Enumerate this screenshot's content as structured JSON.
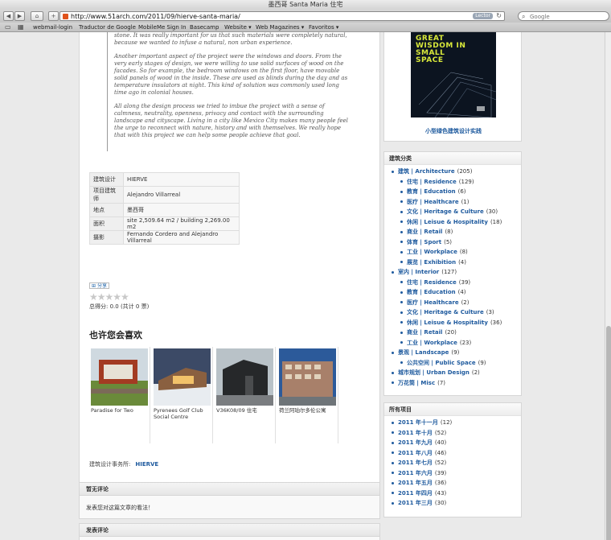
{
  "window": {
    "title": "墨西哥 Santa Maria 住宅",
    "url": "http://www.51arch.com/2011/09/hierve-santa-maria/",
    "reader_label": "Lector",
    "search_placeholder": "Google"
  },
  "bookmarks": [
    "webmail-login",
    "Traductor de Google",
    "MobileMe Sign In",
    "Basecamp",
    "Website ▾",
    "Web Magazines ▾",
    "Favoritos ▾"
  ],
  "article": {
    "paragraphs": [
      "stone. It was really important for us that such materials were completely natural, because we wanted to infuse a natural, non urban experience.",
      "Another important aspect of the project were the windows and doors. From the very early stages of design, we were willing to use solid surfaces of wood on the facades. So for example, the bedroom windows on the first floor, have movable solid panels of wood in the inside. These are used as blinds during the day and as temperature insulators at night. This kind of solution was commonly used long time ago in colonial houses.",
      "All along the design process we tried to imbue the project with a sense of calmness, neutrality, openness, privacy and contact with the surrounding landscape and cityscape. Living in a city like Mexico City makes many people feel the urge to reconnect with nature, history and with themselves. We really hope that with this project we can help some people achieve that goal."
    ],
    "info": [
      {
        "k": "建筑设计",
        "v": "HIERVE"
      },
      {
        "k": "项目建筑师",
        "v": "Alejandro Villarreal"
      },
      {
        "k": "地点",
        "v": "墨西哥"
      },
      {
        "k": "面积",
        "v": "site 2,509.64 m2 / building 2,269.00 m2"
      },
      {
        "k": "摄影",
        "v": "Fernando Cordero and Alejandro Villarreal"
      }
    ],
    "share_label": "分享",
    "stars": "★★★★★",
    "score": "总得分: 0.0 (共计 0 票)",
    "related_title": "也许您会喜欢",
    "related": [
      {
        "caption": "Paradise for Two"
      },
      {
        "caption": "Pyrenees Golf Club Social Centre"
      },
      {
        "caption": "V36K08/09 住宅"
      },
      {
        "caption": "荷兰阿珀尔多伦公寓"
      }
    ],
    "firm_label": "建筑设计事务所:",
    "firm_name": "HIERVE"
  },
  "comments": {
    "none_title": "暂无评论",
    "none_body": "发表您对这篇文章的看法！",
    "post_title": "发表评论"
  },
  "sidebar": {
    "book": {
      "cover_title": "GREAT WISDOM IN SMALL SPACE",
      "caption": "小型绿色建筑设计实践"
    },
    "categories_title": "建筑分类",
    "categories": [
      {
        "label": "建筑 | Architecture",
        "count": "(205)",
        "level": 1
      },
      {
        "label": "住宅 | Residence",
        "count": "(129)",
        "level": 2
      },
      {
        "label": "教育 | Education",
        "count": "(6)",
        "level": 2
      },
      {
        "label": "医疗 | Healthcare",
        "count": "(1)",
        "level": 2
      },
      {
        "label": "文化 | Heritage & Culture",
        "count": "(30)",
        "level": 2
      },
      {
        "label": "休闲 | Leisue & Hospitality",
        "count": "(18)",
        "level": 2
      },
      {
        "label": "商业 | Retail",
        "count": "(8)",
        "level": 2
      },
      {
        "label": "体育 | Sport",
        "count": "(5)",
        "level": 2
      },
      {
        "label": "工业 | Workplace",
        "count": "(8)",
        "level": 2
      },
      {
        "label": "展览 | Exhibition",
        "count": "(4)",
        "level": 2
      },
      {
        "label": "室内 | Interior",
        "count": "(127)",
        "level": 1
      },
      {
        "label": "住宅 | Residence",
        "count": "(39)",
        "level": 2
      },
      {
        "label": "教育 | Education",
        "count": "(4)",
        "level": 2
      },
      {
        "label": "医疗 | Healthcare",
        "count": "(2)",
        "level": 2
      },
      {
        "label": "文化 | Heritage & Culture",
        "count": "(3)",
        "level": 2
      },
      {
        "label": "休闲 | Leisue & Hospitality",
        "count": "(36)",
        "level": 2
      },
      {
        "label": "商业 | Retail",
        "count": "(20)",
        "level": 2
      },
      {
        "label": "工业 | Workplace",
        "count": "(23)",
        "level": 2
      },
      {
        "label": "景观 | Landscape",
        "count": "(9)",
        "level": 1
      },
      {
        "label": "公共空间 | Public Space",
        "count": "(9)",
        "level": 2
      },
      {
        "label": "城市规划 | Urban Design",
        "count": "(2)",
        "level": 1
      },
      {
        "label": "万花筒 | Misc",
        "count": "(7)",
        "level": 1
      }
    ],
    "archive_title": "所有项目",
    "archive": [
      {
        "label": "2011 年十一月",
        "count": "(12)"
      },
      {
        "label": "2011 年十月",
        "count": "(52)"
      },
      {
        "label": "2011 年九月",
        "count": "(40)"
      },
      {
        "label": "2011 年八月",
        "count": "(46)"
      },
      {
        "label": "2011 年七月",
        "count": "(52)"
      },
      {
        "label": "2011 年六月",
        "count": "(39)"
      },
      {
        "label": "2011 年五月",
        "count": "(36)"
      },
      {
        "label": "2011 年四月",
        "count": "(43)"
      },
      {
        "label": "2011 年三月",
        "count": "(30)"
      }
    ]
  }
}
